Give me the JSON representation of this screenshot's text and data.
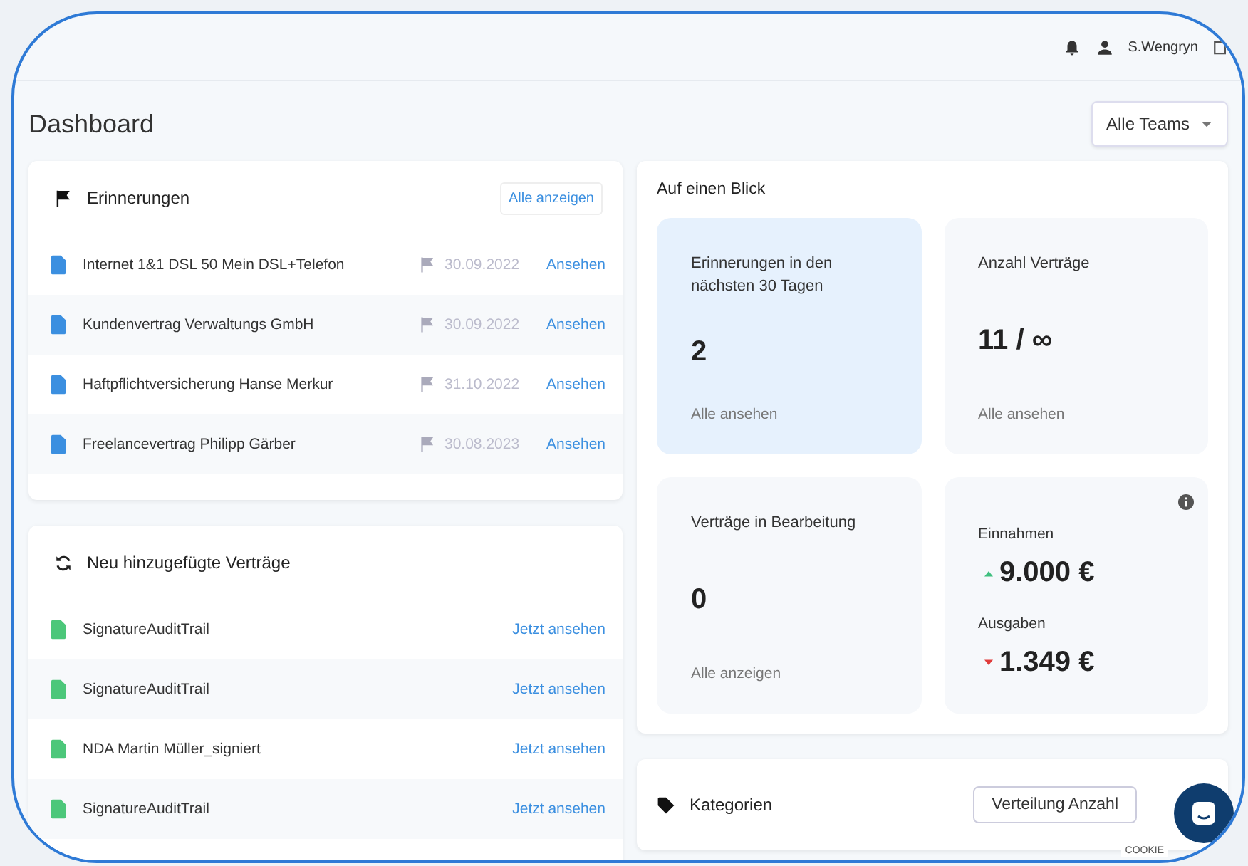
{
  "topbar": {
    "user": "S.Wengryn"
  },
  "page": {
    "title": "Dashboard",
    "team_select": "Alle Teams"
  },
  "reminders": {
    "title": "Erinnerungen",
    "show_all": "Alle anzeigen",
    "items": [
      {
        "name": "Internet 1&1 DSL 50 Mein DSL+Telefon",
        "date": "30.09.2022",
        "action": "Ansehen"
      },
      {
        "name": "Kundenvertrag Verwaltungs GmbH",
        "date": "30.09.2022",
        "action": "Ansehen"
      },
      {
        "name": "Haftpflichtversicherung Hanse Merkur",
        "date": "31.10.2022",
        "action": "Ansehen"
      },
      {
        "name": "Freelancevertrag Philipp Gärber",
        "date": "30.08.2023",
        "action": "Ansehen"
      }
    ]
  },
  "new_contracts": {
    "title": "Neu hinzugefügte Verträge",
    "items": [
      {
        "name": "SignatureAuditTrail",
        "action": "Jetzt ansehen"
      },
      {
        "name": "SignatureAuditTrail",
        "action": "Jetzt ansehen"
      },
      {
        "name": "NDA Martin Müller_signiert",
        "action": "Jetzt ansehen"
      },
      {
        "name": "SignatureAuditTrail",
        "action": "Jetzt ansehen"
      }
    ]
  },
  "glance": {
    "title": "Auf einen Blick",
    "tiles": [
      {
        "kind": "stat",
        "highlighted": true,
        "label": "Erinnerungen in den nächsten 30 Tagen",
        "value": "2",
        "link": "Alle ansehen"
      },
      {
        "kind": "stat",
        "highlighted": false,
        "label": "Anzahl Verträge",
        "value": "11 / ∞",
        "link": "Alle ansehen"
      },
      {
        "kind": "stat",
        "highlighted": false,
        "label": "Verträge in Bearbeitung",
        "value": "0",
        "link": "Alle anzeigen"
      },
      {
        "kind": "finance",
        "highlighted": false,
        "entries": [
          {
            "label": "Einnahmen",
            "value": "9.000 €",
            "kind": "up"
          },
          {
            "label": "Ausgaben",
            "value": "1.349 €",
            "kind": "down"
          }
        ]
      }
    ]
  },
  "categories": {
    "title": "Kategorien",
    "select": "Verteilung Anzahl"
  },
  "cookie_tab": "COOKIE"
}
